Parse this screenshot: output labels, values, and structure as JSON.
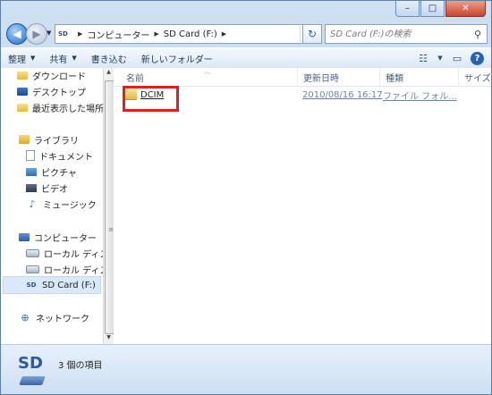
{
  "window": {
    "controls": {
      "minimize": "–",
      "maximize": "□",
      "close": "✕"
    }
  },
  "nav": {
    "back": "◀",
    "forward": "▶",
    "breadcrumb": [
      "コンピューター",
      "SD Card (F:)"
    ],
    "refresh": "↻",
    "search_placeholder": "SD Card (F:)の検索"
  },
  "toolbar": {
    "organize": "整理",
    "share": "共有",
    "burn": "書き込む",
    "new_folder": "新しいフォルダー"
  },
  "sidebar": {
    "favorites": [
      {
        "label": "ダウンロード",
        "icon": "downloads-icon"
      },
      {
        "label": "デスクトップ",
        "icon": "desktop-icon"
      },
      {
        "label": "最近表示した場所",
        "icon": "recent-places-icon"
      }
    ],
    "libraries_label": "ライブラリ",
    "libraries": [
      {
        "label": "ドキュメント",
        "icon": "documents-icon"
      },
      {
        "label": "ピクチャ",
        "icon": "pictures-icon"
      },
      {
        "label": "ビデオ",
        "icon": "videos-icon"
      },
      {
        "label": "ミュージック",
        "icon": "music-icon"
      }
    ],
    "computer_label": "コンピューター",
    "drives": [
      {
        "label": "ローカル ディスク",
        "icon": "local-disk-icon"
      },
      {
        "label": "ローカル ディスク",
        "icon": "local-disk-icon"
      },
      {
        "label": "SD Card (F:)",
        "icon": "sd-card-icon",
        "selected": true
      }
    ],
    "network_label": "ネットワーク"
  },
  "columns": {
    "name": "名前",
    "modified": "更新日時",
    "type": "種類",
    "size": "サイズ"
  },
  "files": [
    {
      "name": "DCIM",
      "modified": "2010/08/16 16:17",
      "type": "ファイル フォル..."
    }
  ],
  "status": {
    "icon_text": "SD",
    "item_count": "3 個の項目"
  },
  "colors": {
    "highlight_box": "#e0201b",
    "selection": "#d9e9fa"
  }
}
